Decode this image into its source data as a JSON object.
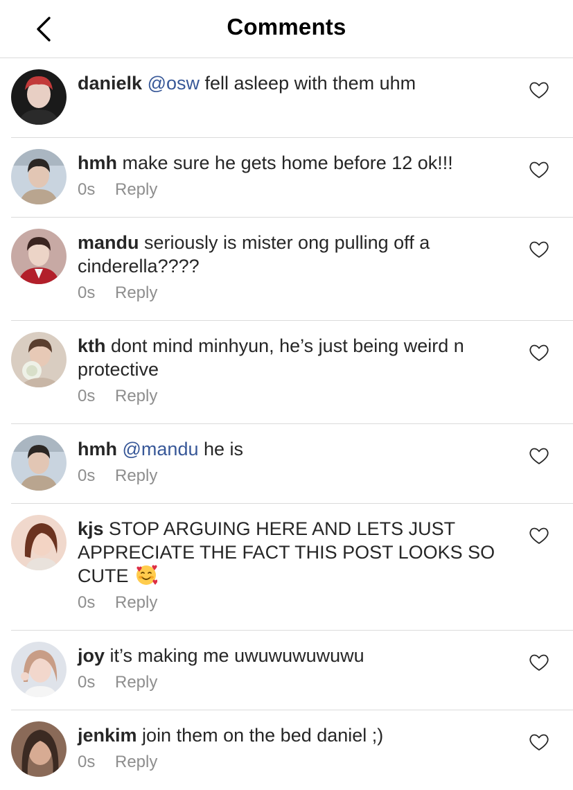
{
  "header": {
    "title": "Comments"
  },
  "comments": [
    {
      "username": "danielk",
      "mention": "@osw",
      "text": " fell asleep with them uhm",
      "time": "",
      "reply": "",
      "avatar_colors": [
        "#1a1a1a",
        "#c23a3a",
        "#e8cfc4"
      ]
    },
    {
      "username": "hmh",
      "mention": "",
      "text": " make sure he gets home before 12 ok!!!",
      "time": "0s",
      "reply": "Reply",
      "avatar_colors": [
        "#c9d4df",
        "#2b2623",
        "#e2c6b4"
      ]
    },
    {
      "username": "mandu",
      "mention": "",
      "text": " seriously is mister ong pulling off a cinderella????",
      "time": "0s",
      "reply": "Reply",
      "avatar_colors": [
        "#c7a9a4",
        "#3a2420",
        "#b21f2a"
      ]
    },
    {
      "username": "kth",
      "mention": "",
      "text": " dont mind minhyun, he’s just being weird n protective",
      "time": "0s",
      "reply": "Reply",
      "avatar_colors": [
        "#d9cdc1",
        "#5a3e2e",
        "#eef1e7"
      ]
    },
    {
      "username": "hmh",
      "mention": "@mandu",
      "text": " he is",
      "time": "0s",
      "reply": "Reply",
      "avatar_colors": [
        "#c9d4df",
        "#2b2623",
        "#e2c6b4"
      ]
    },
    {
      "username": "kjs",
      "mention": "",
      "text": " STOP ARGUING HERE AND LETS JUST APPRECIATE THE FACT THIS POST LOOKS SO CUTE ",
      "emoji": "smiling-face-with-hearts",
      "time": "0s",
      "reply": "Reply",
      "avatar_colors": [
        "#f0d8cc",
        "#6b3320",
        "#f3d4c4"
      ]
    },
    {
      "username": "joy",
      "mention": "",
      "text": " it’s making me uwuwuwuwuwu",
      "time": "0s",
      "reply": "Reply",
      "avatar_colors": [
        "#dfe3ea",
        "#c89d86",
        "#f2d7cc"
      ]
    },
    {
      "username": "jenkim",
      "mention": "",
      "text": " join them on the bed daniel ;)",
      "time": "0s",
      "reply": "Reply",
      "avatar_colors": [
        "#8a6a58",
        "#3b2a22",
        "#d7ab93"
      ]
    }
  ],
  "colors": {
    "mention": "#385898",
    "meta": "#8e8e8e",
    "divider": "#dbdbdb"
  }
}
